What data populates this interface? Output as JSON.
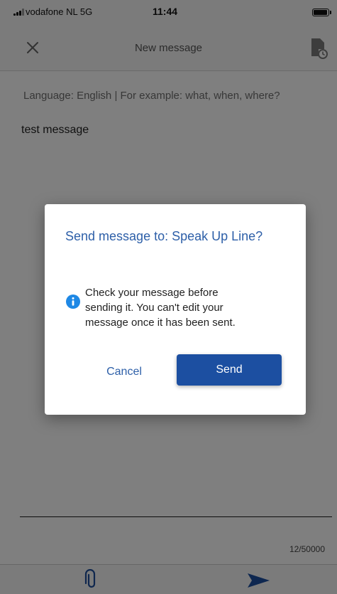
{
  "status_bar": {
    "carrier": "vodafone NL  5G",
    "time": "11:44",
    "battery_level": 0.85,
    "icons": [
      "signal-icon",
      "battery-icon"
    ]
  },
  "header": {
    "title": "New message",
    "icons": [
      "close-icon",
      "document-icon"
    ]
  },
  "compose": {
    "language_hint": "Language: English | For example: what, when, where?",
    "message": "test message",
    "char_counter": "12/50000"
  },
  "bottom_bar": {
    "icons": [
      "paperclip-icon",
      "send-icon"
    ]
  },
  "dialog": {
    "title": "Send message to: Speak Up Line?",
    "body_lines": [
      "Check your message before",
      "sending it. You can't edit your",
      "message once it has been sent."
    ],
    "info_icon": "info-icon",
    "cancel_label": "Cancel",
    "send_label": "Send"
  },
  "colors": {
    "accent": "#2d5fa8",
    "primary_button": "#1c4fa1",
    "info_icon": "#1e88e5",
    "overlay": "rgba(0,0,0,0.5)"
  }
}
